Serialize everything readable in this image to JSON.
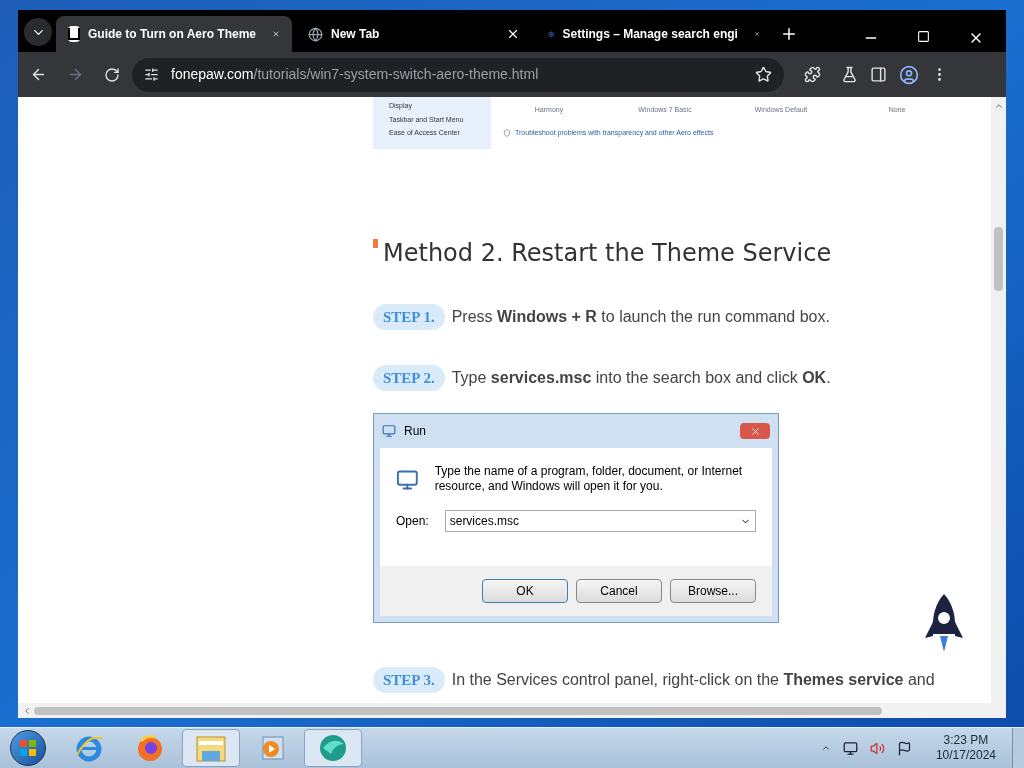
{
  "tabs": [
    {
      "kind": "logo",
      "title": "Guide to Turn on Aero Theme",
      "selected": true
    },
    {
      "kind": "globe",
      "title": "New Tab",
      "selected": false
    },
    {
      "kind": "gear",
      "title": "Settings – Manage search engi",
      "selected": false
    }
  ],
  "address": {
    "domain": "fonepaw.com",
    "path": "/tutorials/win7-system-switch-aero-theme.html"
  },
  "snippet": {
    "links": [
      "Display",
      "Taskbar and Start Menu",
      "Ease of Access Center"
    ],
    "themes": [
      "Harmony",
      "Windows 7 Basic",
      "Windows Default",
      "None"
    ],
    "troubleshoot": "Troubleshoot problems with transparency and other Aero effects"
  },
  "heading": "Method 2. Restart the Theme Service",
  "steps": [
    {
      "badge": "STEP 1.",
      "text": "Press **Windows + R** to launch the run command box."
    },
    {
      "badge": "STEP 2.",
      "text": "Type **services.msc** into the search box and click **OK**.",
      "run_dialog": {
        "title": "Run",
        "message": "Type the name of a program, folder, document, or Internet resource, and Windows will open it for you.",
        "open_label": "Open:",
        "value": "services.msc",
        "buttons": [
          "OK",
          "Cancel",
          "Browse..."
        ]
      }
    },
    {
      "badge": "STEP 3.",
      "text": "In the Services control panel, right-click on the **Themes service** and"
    }
  ],
  "taskbar": [
    {
      "kind": "ie",
      "selected": false
    },
    {
      "kind": "firefox",
      "selected": false
    },
    {
      "kind": "explorer",
      "selected": true
    },
    {
      "kind": "media",
      "selected": false
    },
    {
      "kind": "app",
      "selected": true
    }
  ],
  "clock": {
    "time": "3:23 PM",
    "date": "10/17/2024"
  }
}
